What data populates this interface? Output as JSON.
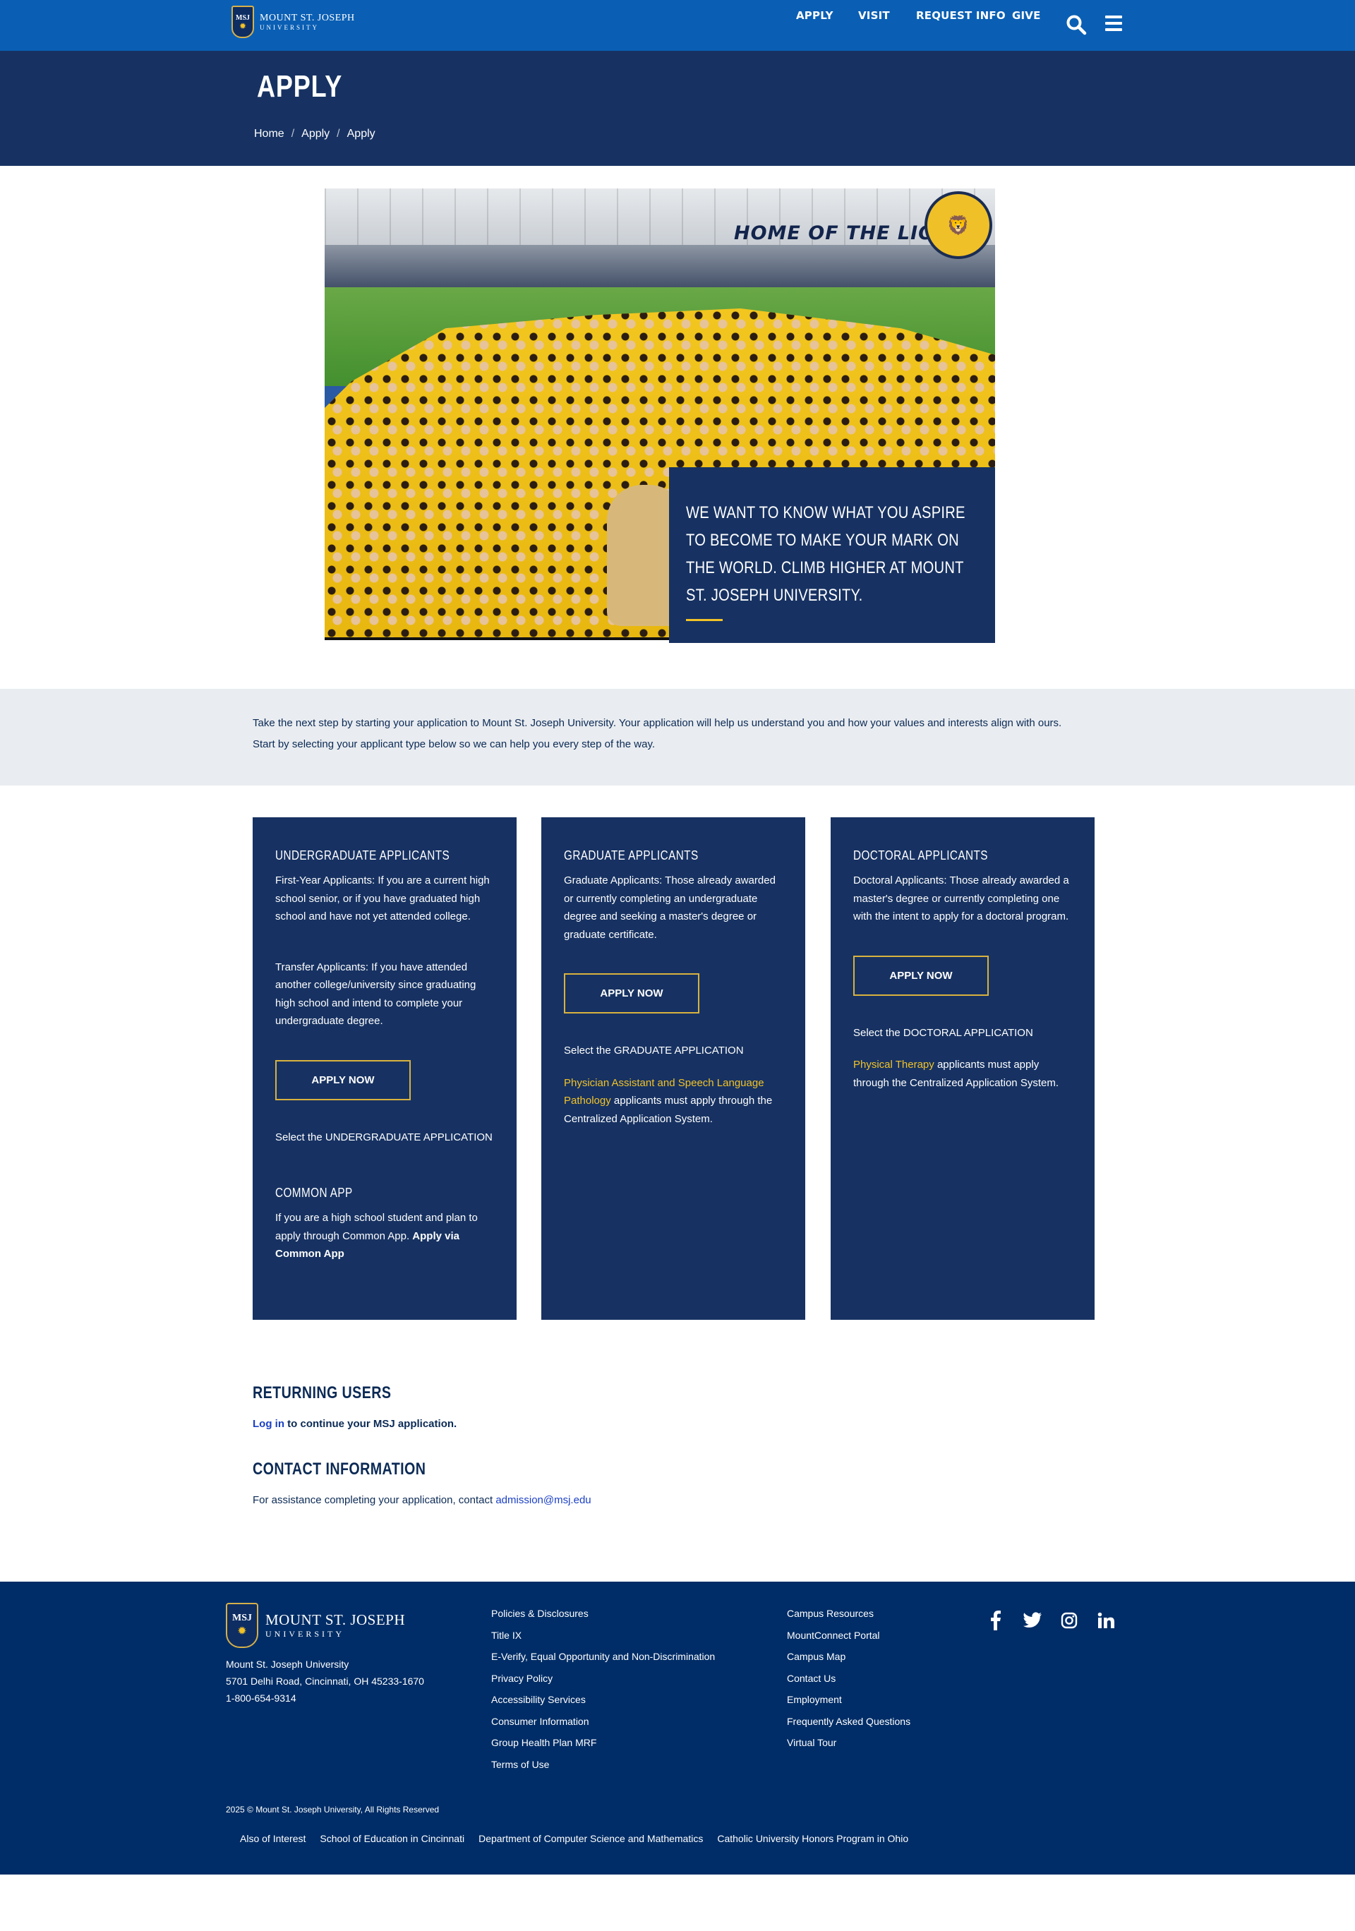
{
  "brand": {
    "name_line1": "MOUNT ST. JOSEPH",
    "name_line2": "UNIVERSITY",
    "crest_text": "MSJ",
    "colors": {
      "primary_blue": "#0a5fb4",
      "navy": "#173262",
      "footer_navy": "#002d67",
      "gold": "#f2c228"
    }
  },
  "topnav": {
    "items": [
      "APPLY",
      "VISIT",
      "REQUEST INFO",
      "GIVE"
    ],
    "search_icon": "search-icon",
    "menu_icon": "hamburger-menu-icon"
  },
  "page": {
    "title": "APPLY",
    "breadcrumb": [
      "Home",
      "Apply",
      "Apply"
    ]
  },
  "hero": {
    "wall_text": "HOME OF THE LIONS",
    "card_text": "WE WANT TO KNOW WHAT YOU ASPIRE TO BECOME TO MAKE YOUR MARK ON THE WORLD. CLIMB HIGHER AT MOUNT ST. JOSEPH UNIVERSITY."
  },
  "intro": {
    "text": "Take the next step by starting your application to Mount St. Joseph University. Your application will help us understand you and how your values and interests align with ours. Start by selecting your applicant type below so we can help you every step of the way."
  },
  "cards": {
    "undergrad": {
      "title": "UNDERGRADUATE APPLICANTS",
      "first_year": "First-Year Applicants: If you are a current high school senior, or if you have graduated high school and have not yet attended college.",
      "transfer": "Transfer Applicants: If you have attended another college/university since graduating high school and intend to complete your undergraduate degree.",
      "button": "APPLY NOW",
      "select_text": "Select the UNDERGRADUATE APPLICATION",
      "common_app_title": "COMMON APP",
      "common_app_text": "If you are a high school student and plan to apply through Common App.",
      "common_app_link": "Apply via Common App"
    },
    "graduate": {
      "title": "GRADUATE APPLICANTS",
      "desc": "Graduate Applicants: Those already awarded or currently completing an undergraduate degree and seeking a master's degree or graduate certificate.",
      "button": "APPLY NOW",
      "select_text": "Select the GRADUATE APPLICATION",
      "link_text": "Physician Assistant and Speech Language Pathology",
      "link_suffix": " applicants must apply through the Centralized Application System."
    },
    "doctoral": {
      "title": "DOCTORAL APPLICANTS",
      "desc": "Doctoral Applicants: Those already awarded a master's degree or currently completing one with the intent to apply for a doctoral program.",
      "button": "APPLY NOW",
      "select_text": "Select the DOCTORAL APPLICATION",
      "link_text": "Physical Therapy",
      "link_suffix": " applicants must apply through the Centralized Application System."
    }
  },
  "returning": {
    "title": "RETURNING USERS",
    "link": "Log in",
    "text": " to continue your MSJ application."
  },
  "contact": {
    "title": "CONTACT INFORMATION",
    "text": "For assistance completing your application, contact ",
    "email": "admission@msj.edu"
  },
  "footer": {
    "address_name": "Mount St. Joseph University",
    "address_street": "5701 Delhi Road, Cincinnati, OH 45233-1670",
    "phone": "1-800-654-9314",
    "col1": [
      "Policies & Disclosures",
      "Title IX",
      "E-Verify, Equal Opportunity and Non-Discrimination",
      "Privacy Policy",
      "Accessibility Services",
      "Consumer Information",
      "Group Health Plan MRF",
      "Terms of Use"
    ],
    "col2": [
      "Campus Resources",
      "MountConnect Portal",
      "Campus Map",
      "Contact Us",
      "Employment",
      "Frequently Asked Questions",
      "Virtual Tour"
    ],
    "social_icons": [
      "facebook-icon",
      "twitter-icon",
      "instagram-icon",
      "linkedin-icon"
    ],
    "copyright": "2025 © Mount St. Joseph University, All Rights Reserved",
    "bottom_links": [
      "Also of Interest",
      "School of Education in Cincinnati",
      "Department of Computer Science and Mathematics",
      "Catholic University Honors Program in Ohio"
    ]
  }
}
